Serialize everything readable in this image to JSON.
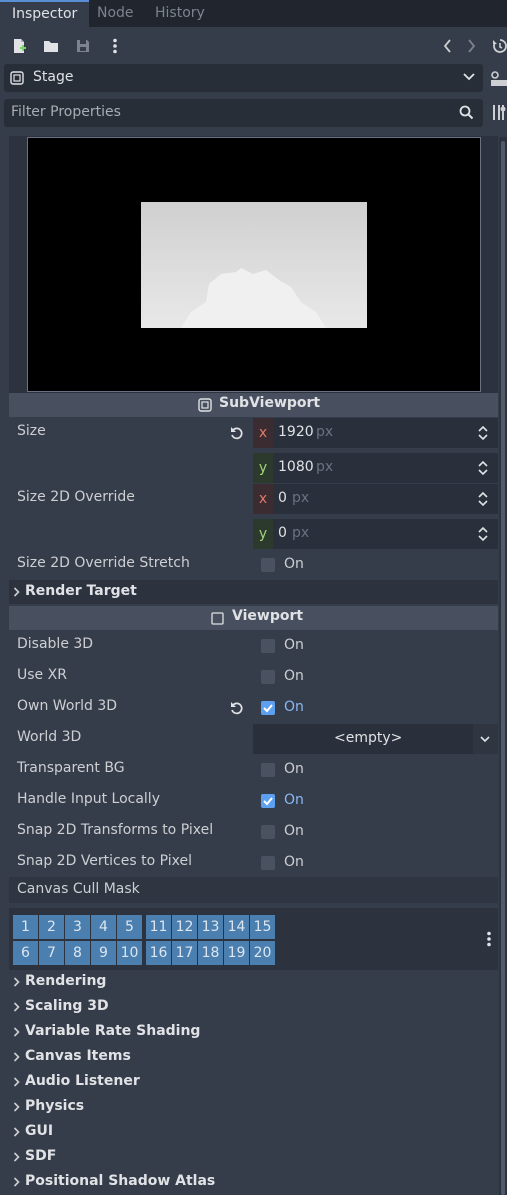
{
  "tabs": [
    {
      "label": "Inspector",
      "active": true
    },
    {
      "label": "Node",
      "active": false
    },
    {
      "label": "History",
      "active": false
    }
  ],
  "toolbar": {
    "icons": [
      "new-resource-icon",
      "open-resource-icon",
      "save-resource-icon",
      "more-icon",
      "back-icon",
      "forward-icon",
      "history-icon"
    ]
  },
  "object_selector": {
    "label": "Stage",
    "icon": "subviewport-icon"
  },
  "filter": {
    "placeholder": "Filter Properties"
  },
  "subviewport_section": {
    "title": "SubViewport",
    "size": {
      "label": "Size",
      "x": "1920",
      "y": "1080",
      "unit": "px"
    },
    "size_2d_override": {
      "label": "Size 2D Override",
      "x": "0",
      "y": "0",
      "unit": "px"
    },
    "size_2d_override_stretch": {
      "label": "Size 2D Override Stretch",
      "value": "On",
      "checked": false
    },
    "render_target": "Render Target"
  },
  "viewport_section": {
    "title": "Viewport",
    "props": [
      {
        "label": "Disable 3D",
        "value": "On",
        "checked": false
      },
      {
        "label": "Use XR",
        "value": "On",
        "checked": false
      },
      {
        "label": "Own World 3D",
        "value": "On",
        "checked": true
      },
      {
        "label": "World 3D",
        "value": "<empty>"
      },
      {
        "label": "Transparent BG",
        "value": "On",
        "checked": false
      },
      {
        "label": "Handle Input Locally",
        "value": "On",
        "checked": true
      },
      {
        "label": "Snap 2D Transforms to Pixel",
        "value": "On",
        "checked": false
      },
      {
        "label": "Snap 2D Vertices to Pixel",
        "value": "On",
        "checked": false
      }
    ],
    "canvas_cull_mask": {
      "label": "Canvas Cull Mask",
      "row1": [
        "1",
        "2",
        "3",
        "4",
        "5",
        "11",
        "12",
        "13",
        "14",
        "15"
      ],
      "row2": [
        "6",
        "7",
        "8",
        "9",
        "10",
        "16",
        "17",
        "18",
        "19",
        "20"
      ]
    }
  },
  "groups": [
    "Rendering",
    "Scaling 3D",
    "Variable Rate Shading",
    "Canvas Items",
    "Audio Listener",
    "Physics",
    "GUI",
    "SDF",
    "Positional Shadow Atlas"
  ],
  "colors": {
    "accent": "#5a8fd6",
    "checked": "#5ea0f0",
    "bit_on": "#4a7fb0"
  }
}
